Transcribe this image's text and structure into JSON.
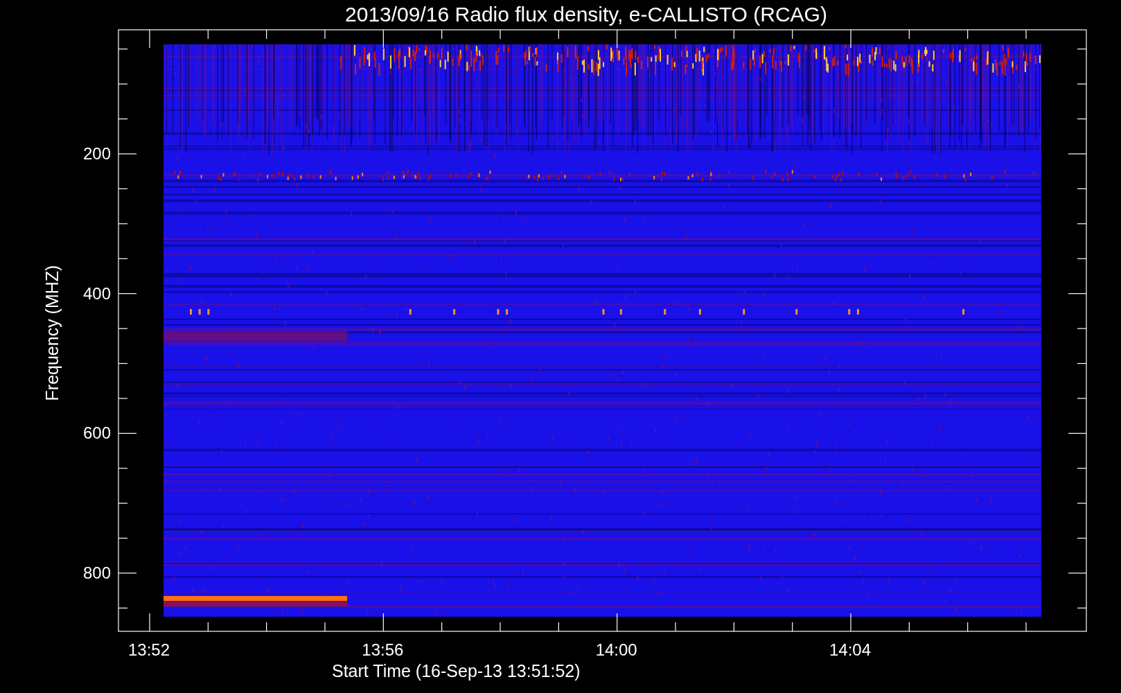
{
  "plot": {
    "title": "2013/09/16  Radio flux density, e-CALLISTO (RCAG)",
    "ylabel": "Frequency (MHZ)",
    "xlabel": "Start Time (16-Sep-13 13:51:52)",
    "yticks": [
      "200",
      "400",
      "600",
      "800"
    ],
    "xticks": [
      "13:52",
      "13:56",
      "14:00",
      "14:04"
    ]
  }
}
